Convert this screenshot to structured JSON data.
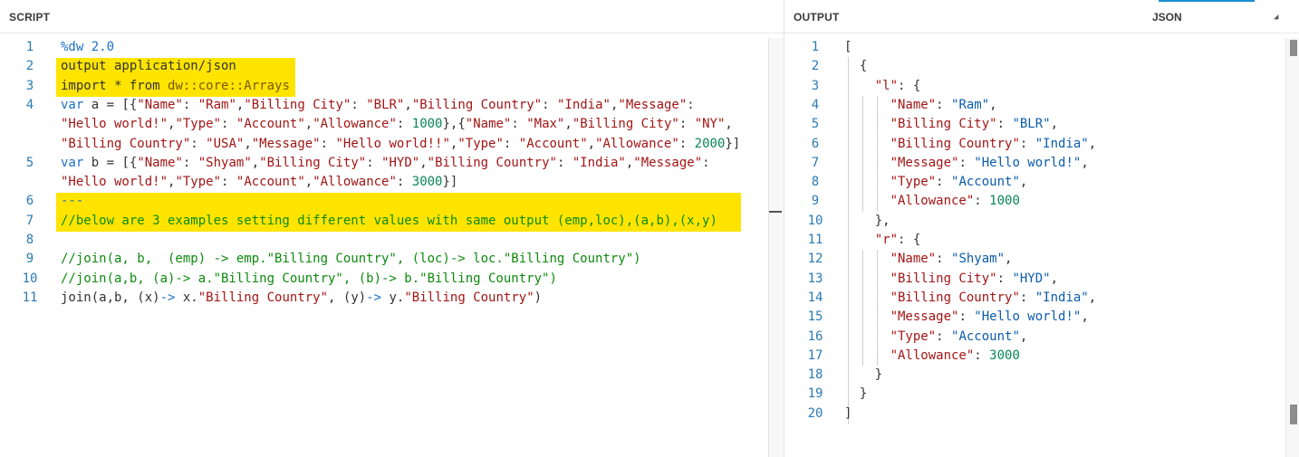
{
  "script_panel": {
    "title": "SCRIPT",
    "lines": [
      {
        "n": "1",
        "tokens": [
          {
            "t": "%dw 2.0",
            "c": "kw"
          }
        ]
      },
      {
        "n": "2",
        "tokens": [
          {
            "t": "output application/json",
            "c": ""
          }
        ]
      },
      {
        "n": "3",
        "tokens": [
          {
            "t": "import * from ",
            "c": ""
          },
          {
            "t": "dw::core::Arrays",
            "c": "dim"
          }
        ]
      },
      {
        "n": "4",
        "tokens": [
          {
            "t": "var",
            "c": "kw"
          },
          {
            "t": " a = [{",
            "c": ""
          },
          {
            "t": "\"Name\"",
            "c": "str"
          },
          {
            "t": ": ",
            "c": ""
          },
          {
            "t": "\"Ram\"",
            "c": "str"
          },
          {
            "t": ",",
            "c": ""
          },
          {
            "t": "\"Billing City\"",
            "c": "str"
          },
          {
            "t": ": ",
            "c": ""
          },
          {
            "t": "\"BLR\"",
            "c": "str"
          },
          {
            "t": ",",
            "c": ""
          },
          {
            "t": "\"Billing Country\"",
            "c": "str"
          },
          {
            "t": ": ",
            "c": ""
          },
          {
            "t": "\"India\"",
            "c": "str"
          },
          {
            "t": ",",
            "c": ""
          },
          {
            "t": "\"Message\"",
            "c": "str"
          },
          {
            "t": ":",
            "c": ""
          }
        ]
      },
      {
        "n": "",
        "tokens": [
          {
            "t": "\"Hello world!\"",
            "c": "str"
          },
          {
            "t": ",",
            "c": ""
          },
          {
            "t": "\"Type\"",
            "c": "str"
          },
          {
            "t": ": ",
            "c": ""
          },
          {
            "t": "\"Account\"",
            "c": "str"
          },
          {
            "t": ",",
            "c": ""
          },
          {
            "t": "\"Allowance\"",
            "c": "str"
          },
          {
            "t": ": ",
            "c": ""
          },
          {
            "t": "1000",
            "c": "num"
          },
          {
            "t": "},{",
            "c": ""
          },
          {
            "t": "\"Name\"",
            "c": "str"
          },
          {
            "t": ": ",
            "c": ""
          },
          {
            "t": "\"Max\"",
            "c": "str"
          },
          {
            "t": ",",
            "c": ""
          },
          {
            "t": "\"Billing City\"",
            "c": "str"
          },
          {
            "t": ": ",
            "c": ""
          },
          {
            "t": "\"NY\"",
            "c": "str"
          },
          {
            "t": ",",
            "c": ""
          }
        ]
      },
      {
        "n": "",
        "tokens": [
          {
            "t": "\"Billing Country\"",
            "c": "str"
          },
          {
            "t": ": ",
            "c": ""
          },
          {
            "t": "\"USA\"",
            "c": "str"
          },
          {
            "t": ",",
            "c": ""
          },
          {
            "t": "\"Message\"",
            "c": "str"
          },
          {
            "t": ": ",
            "c": ""
          },
          {
            "t": "\"Hello world!!\"",
            "c": "str"
          },
          {
            "t": ",",
            "c": ""
          },
          {
            "t": "\"Type\"",
            "c": "str"
          },
          {
            "t": ": ",
            "c": ""
          },
          {
            "t": "\"Account\"",
            "c": "str"
          },
          {
            "t": ",",
            "c": ""
          },
          {
            "t": "\"Allowance\"",
            "c": "str"
          },
          {
            "t": ": ",
            "c": ""
          },
          {
            "t": "2000",
            "c": "num"
          },
          {
            "t": "}]",
            "c": ""
          }
        ]
      },
      {
        "n": "5",
        "tokens": [
          {
            "t": "var",
            "c": "kw"
          },
          {
            "t": " b = [{",
            "c": ""
          },
          {
            "t": "\"Name\"",
            "c": "str"
          },
          {
            "t": ": ",
            "c": ""
          },
          {
            "t": "\"Shyam\"",
            "c": "str"
          },
          {
            "t": ",",
            "c": ""
          },
          {
            "t": "\"Billing City\"",
            "c": "str"
          },
          {
            "t": ": ",
            "c": ""
          },
          {
            "t": "\"HYD\"",
            "c": "str"
          },
          {
            "t": ",",
            "c": ""
          },
          {
            "t": "\"Billing Country\"",
            "c": "str"
          },
          {
            "t": ": ",
            "c": ""
          },
          {
            "t": "\"India\"",
            "c": "str"
          },
          {
            "t": ",",
            "c": ""
          },
          {
            "t": "\"Message\"",
            "c": "str"
          },
          {
            "t": ":",
            "c": ""
          }
        ]
      },
      {
        "n": "",
        "tokens": [
          {
            "t": "\"Hello world!\"",
            "c": "str"
          },
          {
            "t": ",",
            "c": ""
          },
          {
            "t": "\"Type\"",
            "c": "str"
          },
          {
            "t": ": ",
            "c": ""
          },
          {
            "t": "\"Account\"",
            "c": "str"
          },
          {
            "t": ",",
            "c": ""
          },
          {
            "t": "\"Allowance\"",
            "c": "str"
          },
          {
            "t": ": ",
            "c": ""
          },
          {
            "t": "3000",
            "c": "num"
          },
          {
            "t": "}]",
            "c": ""
          }
        ]
      },
      {
        "n": "6",
        "tokens": [
          {
            "t": "---",
            "c": "kw"
          }
        ]
      },
      {
        "n": "7",
        "tokens": [
          {
            "t": "//below are 3 examples setting different values with same output (emp,loc),(a,b),(x,y)",
            "c": "cm"
          }
        ]
      },
      {
        "n": "8",
        "tokens": []
      },
      {
        "n": "9",
        "tokens": [
          {
            "t": "//join(a, b,  (emp) -> emp.\"Billing Country\", (loc)-> loc.\"Billing Country\")",
            "c": "cm"
          }
        ]
      },
      {
        "n": "10",
        "tokens": [
          {
            "t": "//join(a,b, (a)-> a.\"Billing Country\", (b)-> b.\"Billing Country\")",
            "c": "cm"
          }
        ]
      },
      {
        "n": "11",
        "tokens": [
          {
            "t": "join(a,b, (x)",
            "c": ""
          },
          {
            "t": "->",
            "c": "kw"
          },
          {
            "t": " x.",
            "c": ""
          },
          {
            "t": "\"Billing Country\"",
            "c": "str"
          },
          {
            "t": ", (y)",
            "c": ""
          },
          {
            "t": "->",
            "c": "kw"
          },
          {
            "t": " y.",
            "c": ""
          },
          {
            "t": "\"Billing Country\"",
            "c": "str"
          },
          {
            "t": ")",
            "c": ""
          }
        ]
      }
    ]
  },
  "output_panel": {
    "title": "OUTPUT",
    "format_label": "JSON",
    "format_arrow": "◢",
    "lines": [
      {
        "n": "1",
        "tokens": [
          {
            "t": "[",
            "c": ""
          }
        ]
      },
      {
        "n": "2",
        "tokens": [
          {
            "t": "  {",
            "c": ""
          }
        ]
      },
      {
        "n": "3",
        "tokens": [
          {
            "t": "    ",
            "c": ""
          },
          {
            "t": "\"l\"",
            "c": "str"
          },
          {
            "t": ": {",
            "c": ""
          }
        ]
      },
      {
        "n": "4",
        "tokens": [
          {
            "t": "      ",
            "c": ""
          },
          {
            "t": "\"Name\"",
            "c": "str"
          },
          {
            "t": ": ",
            "c": ""
          },
          {
            "t": "\"Ram\"",
            "c": "val"
          },
          {
            "t": ",",
            "c": ""
          }
        ]
      },
      {
        "n": "5",
        "tokens": [
          {
            "t": "      ",
            "c": ""
          },
          {
            "t": "\"Billing City\"",
            "c": "str"
          },
          {
            "t": ": ",
            "c": ""
          },
          {
            "t": "\"BLR\"",
            "c": "val"
          },
          {
            "t": ",",
            "c": ""
          }
        ]
      },
      {
        "n": "6",
        "tokens": [
          {
            "t": "      ",
            "c": ""
          },
          {
            "t": "\"Billing Country\"",
            "c": "str"
          },
          {
            "t": ": ",
            "c": ""
          },
          {
            "t": "\"India\"",
            "c": "val"
          },
          {
            "t": ",",
            "c": ""
          }
        ]
      },
      {
        "n": "7",
        "tokens": [
          {
            "t": "      ",
            "c": ""
          },
          {
            "t": "\"Message\"",
            "c": "str"
          },
          {
            "t": ": ",
            "c": ""
          },
          {
            "t": "\"Hello world!\"",
            "c": "val"
          },
          {
            "t": ",",
            "c": ""
          }
        ]
      },
      {
        "n": "8",
        "tokens": [
          {
            "t": "      ",
            "c": ""
          },
          {
            "t": "\"Type\"",
            "c": "str"
          },
          {
            "t": ": ",
            "c": ""
          },
          {
            "t": "\"Account\"",
            "c": "val"
          },
          {
            "t": ",",
            "c": ""
          }
        ]
      },
      {
        "n": "9",
        "tokens": [
          {
            "t": "      ",
            "c": ""
          },
          {
            "t": "\"Allowance\"",
            "c": "str"
          },
          {
            "t": ": ",
            "c": ""
          },
          {
            "t": "1000",
            "c": "num"
          }
        ]
      },
      {
        "n": "10",
        "tokens": [
          {
            "t": "    },",
            "c": ""
          }
        ]
      },
      {
        "n": "11",
        "tokens": [
          {
            "t": "    ",
            "c": ""
          },
          {
            "t": "\"r\"",
            "c": "str"
          },
          {
            "t": ": {",
            "c": ""
          }
        ]
      },
      {
        "n": "12",
        "tokens": [
          {
            "t": "      ",
            "c": ""
          },
          {
            "t": "\"Name\"",
            "c": "str"
          },
          {
            "t": ": ",
            "c": ""
          },
          {
            "t": "\"Shyam\"",
            "c": "val"
          },
          {
            "t": ",",
            "c": ""
          }
        ]
      },
      {
        "n": "13",
        "tokens": [
          {
            "t": "      ",
            "c": ""
          },
          {
            "t": "\"Billing City\"",
            "c": "str"
          },
          {
            "t": ": ",
            "c": ""
          },
          {
            "t": "\"HYD\"",
            "c": "val"
          },
          {
            "t": ",",
            "c": ""
          }
        ]
      },
      {
        "n": "14",
        "tokens": [
          {
            "t": "      ",
            "c": ""
          },
          {
            "t": "\"Billing Country\"",
            "c": "str"
          },
          {
            "t": ": ",
            "c": ""
          },
          {
            "t": "\"India\"",
            "c": "val"
          },
          {
            "t": ",",
            "c": ""
          }
        ]
      },
      {
        "n": "15",
        "tokens": [
          {
            "t": "      ",
            "c": ""
          },
          {
            "t": "\"Message\"",
            "c": "str"
          },
          {
            "t": ": ",
            "c": ""
          },
          {
            "t": "\"Hello world!\"",
            "c": "val"
          },
          {
            "t": ",",
            "c": ""
          }
        ]
      },
      {
        "n": "16",
        "tokens": [
          {
            "t": "      ",
            "c": ""
          },
          {
            "t": "\"Type\"",
            "c": "str"
          },
          {
            "t": ": ",
            "c": ""
          },
          {
            "t": "\"Account\"",
            "c": "val"
          },
          {
            "t": ",",
            "c": ""
          }
        ]
      },
      {
        "n": "17",
        "tokens": [
          {
            "t": "      ",
            "c": ""
          },
          {
            "t": "\"Allowance\"",
            "c": "str"
          },
          {
            "t": ": ",
            "c": ""
          },
          {
            "t": "3000",
            "c": "num"
          }
        ]
      },
      {
        "n": "18",
        "tokens": [
          {
            "t": "    }",
            "c": ""
          }
        ]
      },
      {
        "n": "19",
        "tokens": [
          {
            "t": "  }",
            "c": ""
          }
        ]
      },
      {
        "n": "20",
        "tokens": [
          {
            "t": "]",
            "c": ""
          }
        ]
      }
    ]
  },
  "colors": {
    "highlight": "#ffe400",
    "keyword": "#1e6fc8",
    "string": "#a31515",
    "number": "#098658",
    "comment": "#0d8a0d",
    "accent": "#1a8fd0"
  }
}
